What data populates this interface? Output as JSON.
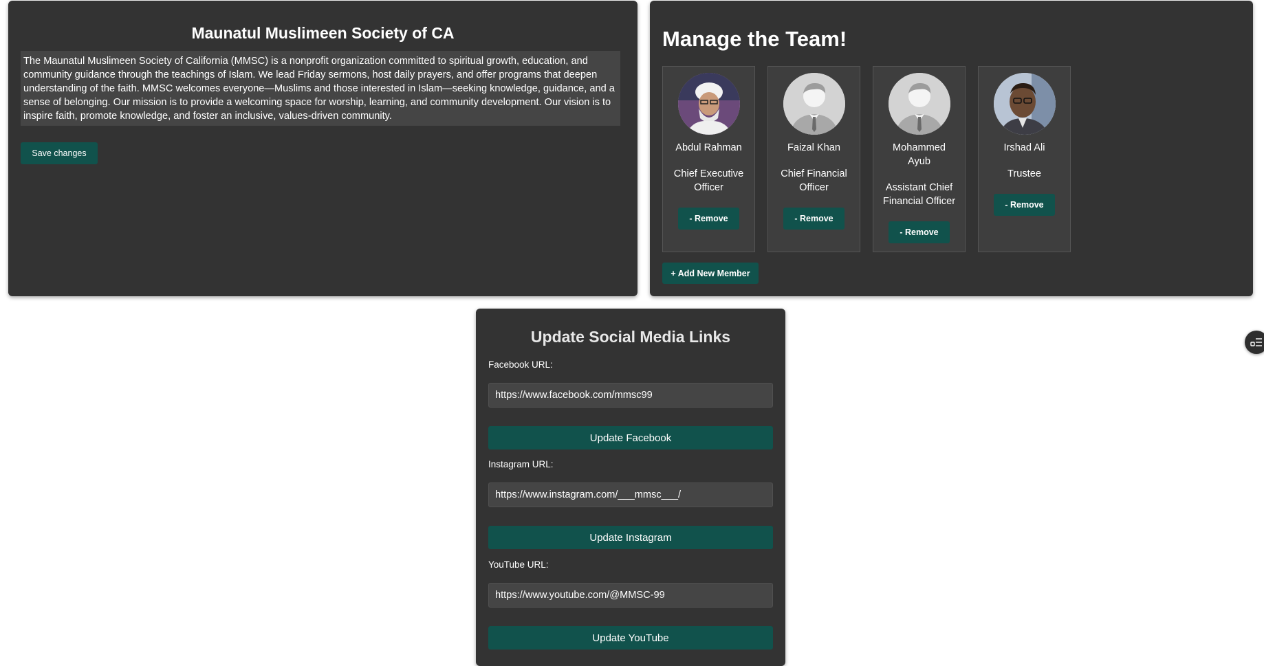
{
  "about": {
    "title": "Maunatul Muslimeen Society of CA",
    "description": "The Maunatul Muslimeen Society of California (MMSC) is a nonprofit organization committed to spiritual growth, education, and community guidance through the teachings of Islam. We lead Friday sermons, host daily prayers, and offer programs that deepen understanding of the faith. MMSC welcomes everyone—Muslims and those interested in Islam—seeking knowledge, guidance, and a sense of belonging. Our mission is to provide a welcoming space for worship, learning, and community development. Our vision is to inspire faith, promote knowledge, and foster an inclusive, values-driven community.",
    "save_label": "Save changes"
  },
  "team": {
    "title": "Manage the Team!",
    "remove_label": "- Remove",
    "add_label": "+ Add New Member",
    "members": [
      {
        "name": "Abdul Rahman",
        "role": "Chief Executive Officer",
        "avatar": "photo"
      },
      {
        "name": "Faizal Khan",
        "role": "Chief Financial Officer",
        "avatar": "placeholder-person-icon"
      },
      {
        "name": "Mohammed Ayub",
        "role": "Assistant Chief Financial Officer",
        "avatar": "placeholder-person-icon"
      },
      {
        "name": "Irshad Ali",
        "role": "Trustee",
        "avatar": "photo"
      }
    ]
  },
  "social": {
    "title": "Update Social Media Links",
    "facebook": {
      "label": "Facebook URL:",
      "value": "https://www.facebook.com/mmsc99",
      "button": "Update Facebook"
    },
    "instagram": {
      "label": "Instagram URL:",
      "value": "https://www.instagram.com/___mmsc___/",
      "button": "Update Instagram"
    },
    "youtube": {
      "label": "YouTube URL:",
      "value": "https://www.youtube.com/@MMSC-99",
      "button": "Update YouTube"
    }
  },
  "colors": {
    "panel": "#333333",
    "accent_button": "#11524c",
    "field": "#454545"
  }
}
